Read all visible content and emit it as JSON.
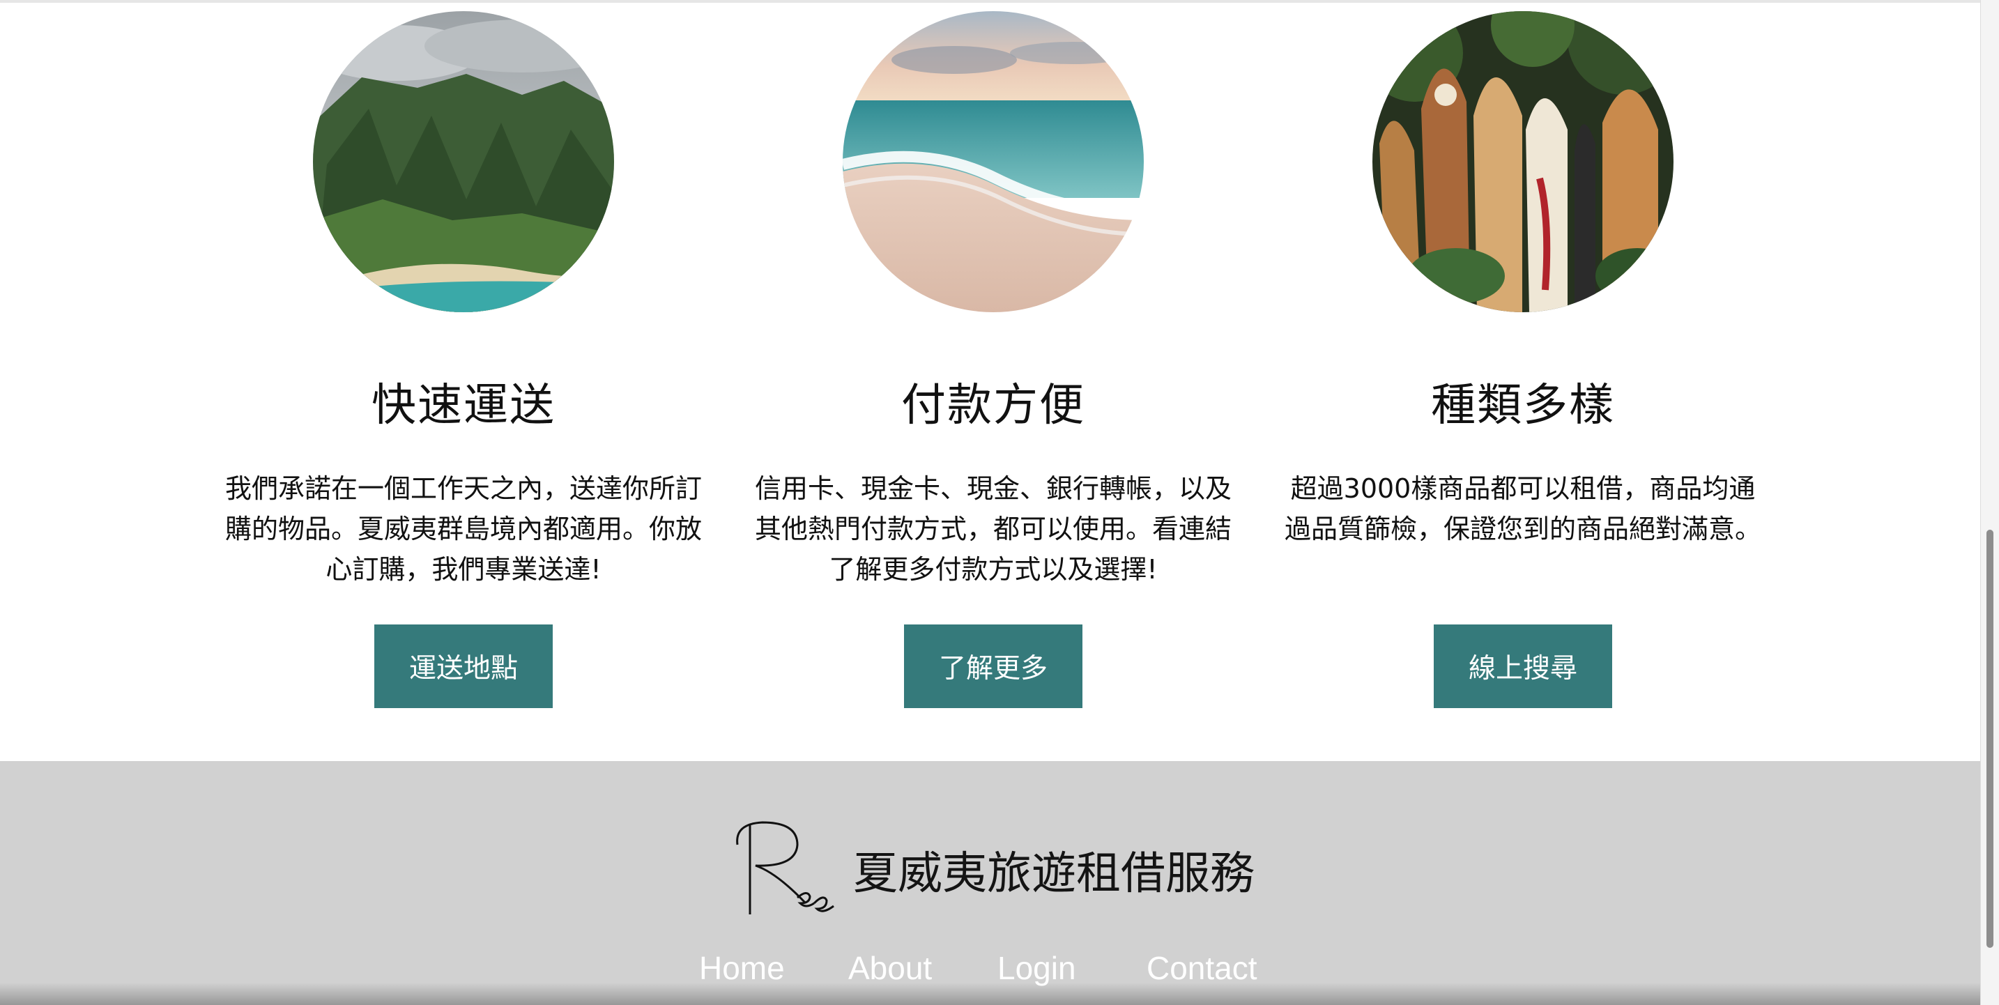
{
  "features": [
    {
      "image_icon": "mountain-coast-photo",
      "title": "快速運送",
      "description": "我們承諾在一個工作天之內，送達你所訂購的物品。夏威夷群島境內都適用。你放心訂購，我們專業送達!",
      "button_label": "運送地點"
    },
    {
      "image_icon": "beach-waves-photo",
      "title": "付款方便",
      "description": "信用卡、現金卡、現金、銀行轉帳，以及其他熱門付款方式，都可以使用。看連結了解更多付款方式以及選擇!",
      "button_label": "了解更多"
    },
    {
      "image_icon": "surfboards-photo",
      "title": "種類多樣",
      "description": "超過3000樣商品都可以租借，商品均通過品質篩檢，保證您到的商品絕對滿意。",
      "button_label": "線上搜尋"
    }
  ],
  "footer": {
    "brand_name": "夏威夷旅遊租借服務",
    "logo_icon": "ree-signature-logo",
    "nav": [
      "Home",
      "About",
      "Login",
      "Contact"
    ]
  },
  "colors": {
    "accent": "#357a7b",
    "footer_bg": "#d1d1d1",
    "nav_text": "#ffffff"
  }
}
